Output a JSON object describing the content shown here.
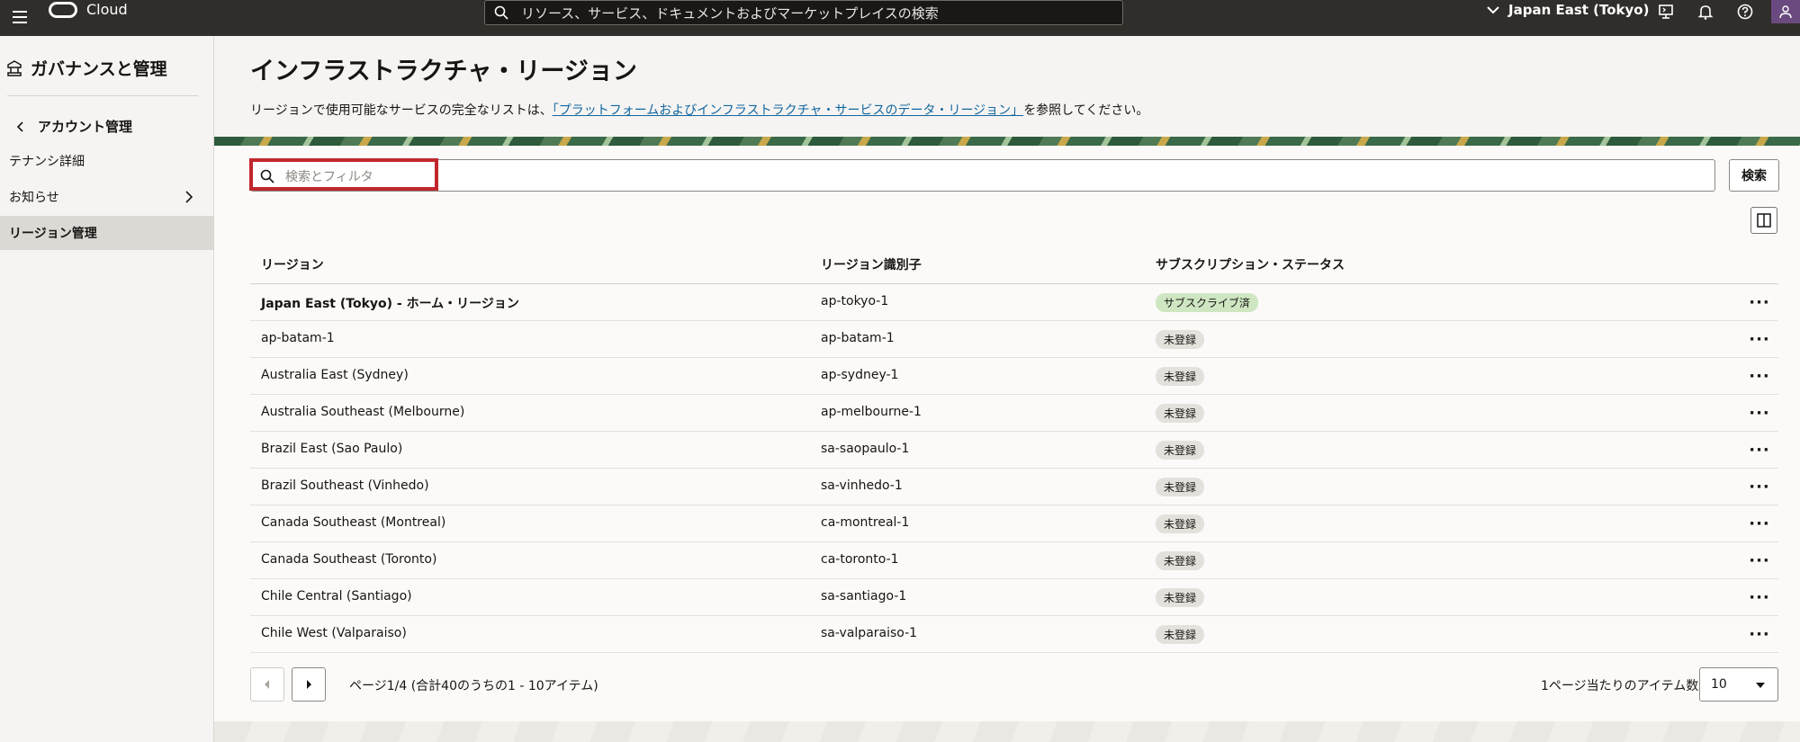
{
  "topbar": {
    "brand": "Cloud",
    "search_placeholder": "リソース、サービス、ドキュメントおよびマーケットプレイスの検索",
    "region": "Japan East (Tokyo)"
  },
  "sidebar": {
    "title": "ガバナンスと管理",
    "back_label": "アカウント管理",
    "items": [
      {
        "label": "テナンシ詳細"
      },
      {
        "label": "お知らせ"
      },
      {
        "label": "リージョン管理"
      }
    ]
  },
  "main": {
    "title": "インフラストラクチャ・リージョン",
    "desc_prefix": "リージョンで使用可能なサービスの完全なリストは、",
    "desc_link": "「プラットフォームおよびインフラストラクチャ・サービスのデータ・リージョン」",
    "desc_suffix": "を参照してください。",
    "filter_placeholder": "検索とフィルタ",
    "search_button": "検索"
  },
  "table": {
    "headers": [
      "リージョン",
      "リージョン識別子",
      "サブスクリプション・ステータス"
    ],
    "rows": [
      {
        "region": "Japan East (Tokyo) - ホーム・リージョン",
        "id": "ap-tokyo-1",
        "status": "サブスクライブ済"
      },
      {
        "region": "ap-batam-1",
        "id": "ap-batam-1",
        "status": "未登録"
      },
      {
        "region": "Australia East (Sydney)",
        "id": "ap-sydney-1",
        "status": "未登録"
      },
      {
        "region": "Australia Southeast (Melbourne)",
        "id": "ap-melbourne-1",
        "status": "未登録"
      },
      {
        "region": "Brazil East (Sao Paulo)",
        "id": "sa-saopaulo-1",
        "status": "未登録"
      },
      {
        "region": "Brazil Southeast (Vinhedo)",
        "id": "sa-vinhedo-1",
        "status": "未登録"
      },
      {
        "region": "Canada Southeast (Montreal)",
        "id": "ca-montreal-1",
        "status": "未登録"
      },
      {
        "region": "Canada Southeast (Toronto)",
        "id": "ca-toronto-1",
        "status": "未登録"
      },
      {
        "region": "Chile Central (Santiago)",
        "id": "sa-santiago-1",
        "status": "未登録"
      },
      {
        "region": "Chile West (Valparaiso)",
        "id": "sa-valparaiso-1",
        "status": "未登録"
      }
    ]
  },
  "pagination": {
    "text": "ページ1/4 (合計40のうちの1 - 10アイテム)",
    "per_page_label": "1ページ当たりのアイテム数",
    "per_page_value": "10"
  },
  "colors": {
    "topbar": "#312d2a",
    "highlight": "#c0272d",
    "subscribed_badge": "#cfe6c2",
    "link": "#1166a0"
  }
}
